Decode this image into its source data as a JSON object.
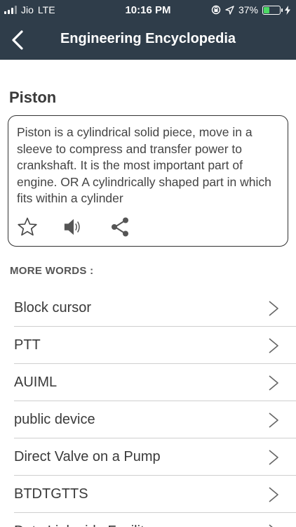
{
  "status": {
    "carrier": "Jio",
    "network": "LTE",
    "time": "10:16 PM",
    "battery": "37%",
    "battery_level": 0.37,
    "battery_color": "#4cd964"
  },
  "nav": {
    "title": "Engineering Encyclopedia",
    "background": "#2f3d4a"
  },
  "word": {
    "title": "Piston",
    "definition": "Piston is a cylindrical solid piece, move in a sleeve to compress and transfer power to crankshaft. It is the most important part of engine. OR A cylindrically shaped part in which fits within a cylinder",
    "actions": [
      "star-icon",
      "speaker-icon",
      "share-icon"
    ]
  },
  "more_words": {
    "heading": "MORE WORDS :",
    "items": [
      {
        "label": "Block cursor"
      },
      {
        "label": "PTT"
      },
      {
        "label": "AUIML"
      },
      {
        "label": "public device"
      },
      {
        "label": "Direct Valve on a Pump"
      },
      {
        "label": "BTDTGTTS"
      },
      {
        "label": "Data Link-side Facility"
      }
    ]
  }
}
